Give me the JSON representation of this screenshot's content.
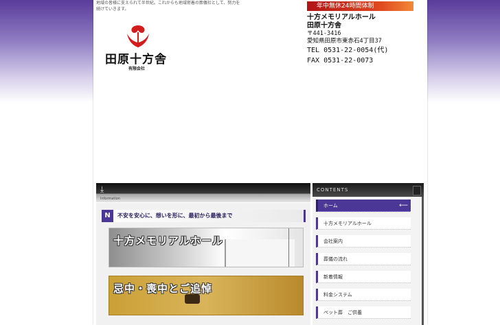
{
  "header": {
    "intro_text": "地域の皆様に支えられて半世紀。これからも地域密着の葬儀社として、努力を続けていきます。",
    "logo_text": "田原十方舎",
    "logo_sub": "有限会社",
    "badge": "年中無休24時間体制",
    "contact": {
      "hall": "十方メモリアルホール",
      "company": "田原十方舎",
      "zip": "〒441-3416",
      "address": "愛知県田原市東赤石4丁目37",
      "tel": "TEL 0531-22-0054(代)",
      "fax": "FAX 0531-22-0073"
    }
  },
  "info": {
    "label": "Information",
    "tag_letter": "N",
    "tagline": "不安を安心に、想いを形に、最初から最後まで",
    "banners": [
      "十方メモリアルホール",
      "忌中・喪中とご追悼"
    ]
  },
  "contents": {
    "title": "CONTENTS",
    "items": [
      {
        "label": "ホーム"
      },
      {
        "label": "十方メモリアルホール"
      },
      {
        "label": "会社案内"
      },
      {
        "label": "葬儀の流れ"
      },
      {
        "label": "新着情報"
      },
      {
        "label": "料金システム"
      },
      {
        "label": "ペット葬　ご供養"
      }
    ]
  },
  "colors": {
    "accent": "#4a3796",
    "badge": "#d83a1e"
  }
}
